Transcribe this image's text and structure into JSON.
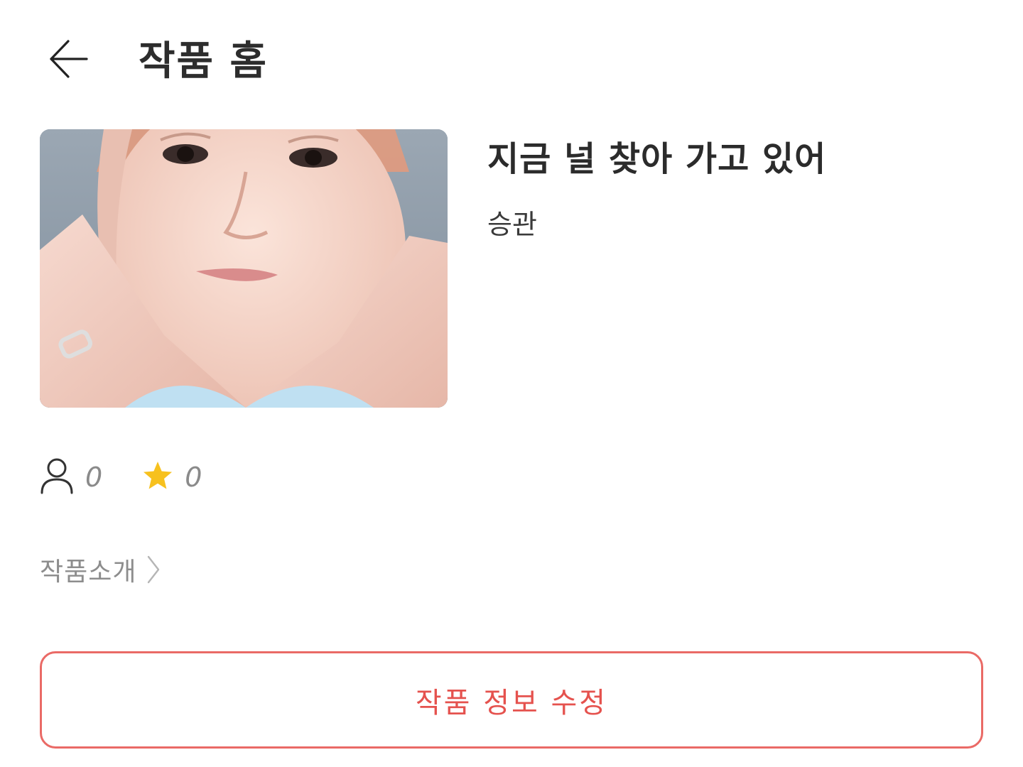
{
  "header": {
    "back_icon": "arrow-left-icon",
    "title": "작품 홈"
  },
  "work": {
    "cover_icon": "cover-image",
    "title": "지금 널 찾아 가고 있어",
    "author": "승관"
  },
  "stats": {
    "readers": {
      "icon": "person-icon",
      "value": "0"
    },
    "favorites": {
      "icon": "star-icon",
      "value": "0",
      "color": "#f7c11e"
    }
  },
  "intro": {
    "label": "작품소개",
    "icon": "chevron-right-icon"
  },
  "edit_button": {
    "label": "작품 정보 수정",
    "color": "#e5524e"
  }
}
